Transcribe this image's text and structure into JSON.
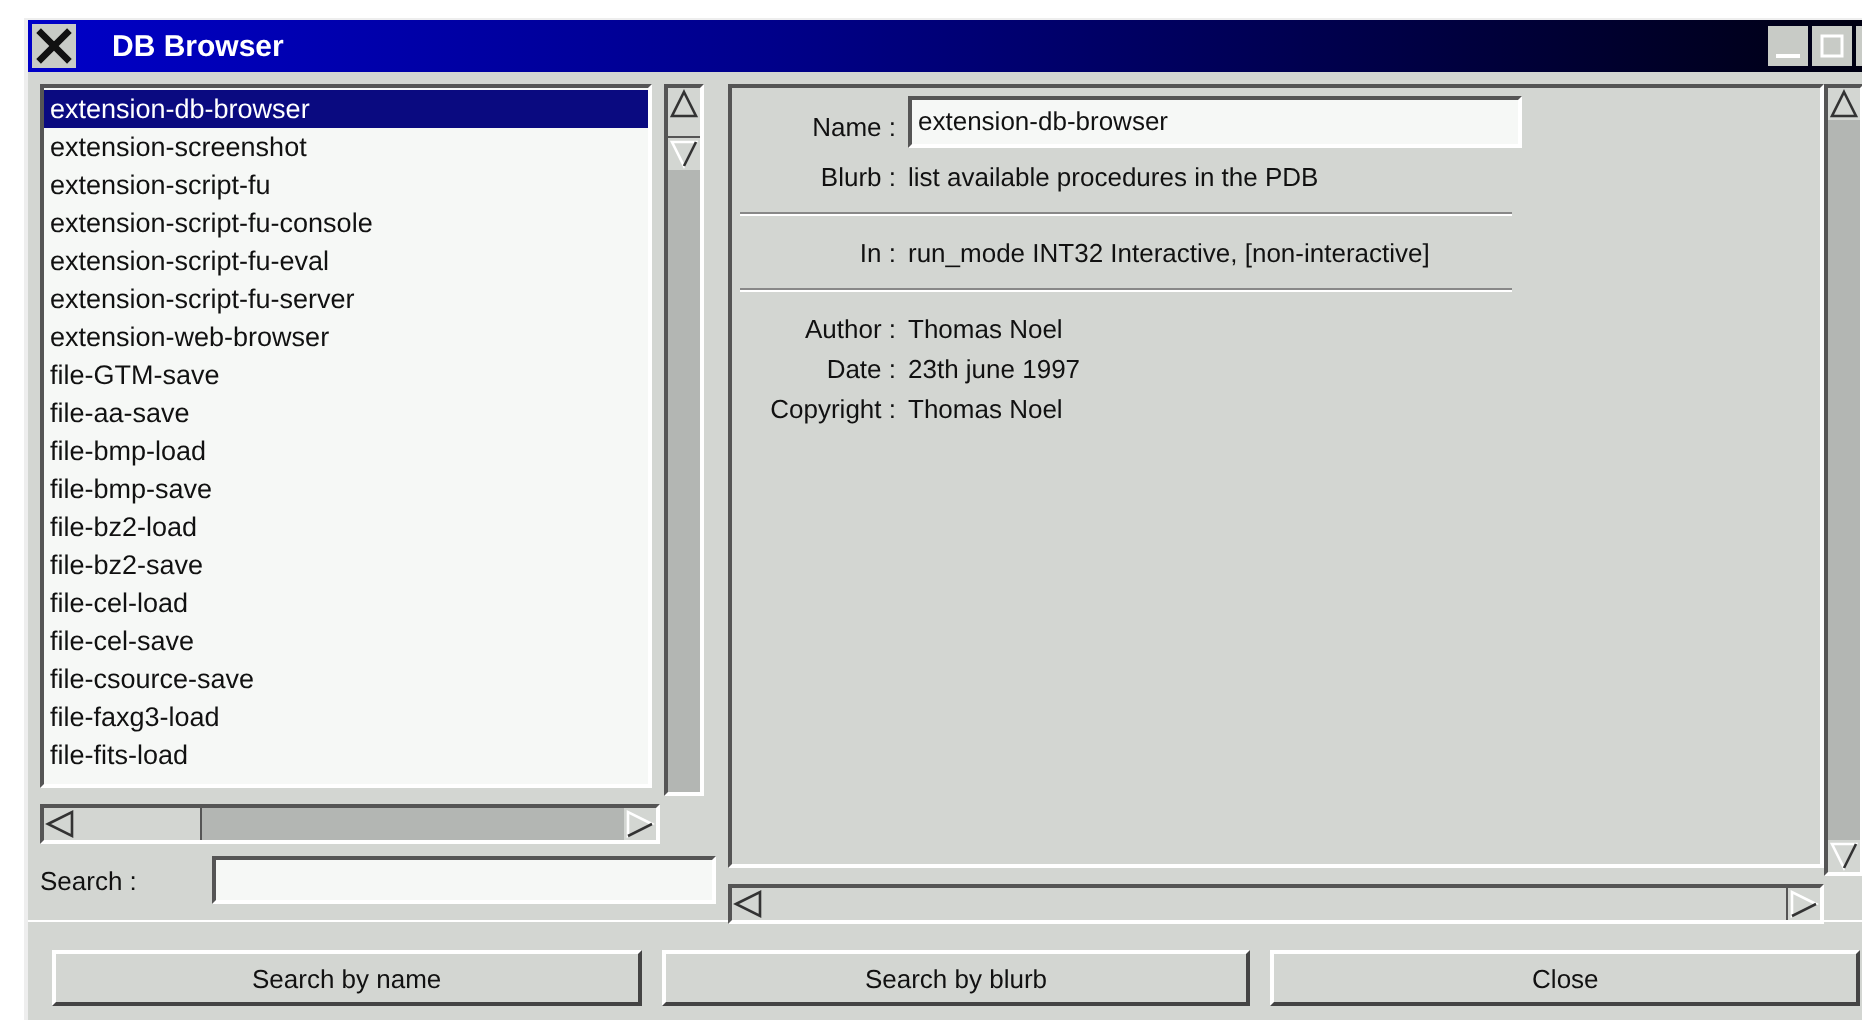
{
  "window": {
    "title": "DB Browser"
  },
  "procedures": [
    {
      "name": "extension-db-browser",
      "selected": true
    },
    {
      "name": "extension-screenshot",
      "selected": false
    },
    {
      "name": "extension-script-fu",
      "selected": false
    },
    {
      "name": "extension-script-fu-console",
      "selected": false
    },
    {
      "name": "extension-script-fu-eval",
      "selected": false
    },
    {
      "name": "extension-script-fu-server",
      "selected": false
    },
    {
      "name": "extension-web-browser",
      "selected": false
    },
    {
      "name": "file-GTM-save",
      "selected": false
    },
    {
      "name": "file-aa-save",
      "selected": false
    },
    {
      "name": "file-bmp-load",
      "selected": false
    },
    {
      "name": "file-bmp-save",
      "selected": false
    },
    {
      "name": "file-bz2-load",
      "selected": false
    },
    {
      "name": "file-bz2-save",
      "selected": false
    },
    {
      "name": "file-cel-load",
      "selected": false
    },
    {
      "name": "file-cel-save",
      "selected": false
    },
    {
      "name": "file-csource-save",
      "selected": false
    },
    {
      "name": "file-faxg3-load",
      "selected": false
    },
    {
      "name": "file-fits-load",
      "selected": false
    }
  ],
  "search": {
    "label": "Search :"
  },
  "detail_groups": [
    {
      "rows": [
        {
          "label": "Name :",
          "value": "extension-db-browser",
          "kind": "field"
        },
        {
          "label": "Blurb :",
          "value": "list available procedures in the PDB",
          "kind": "text"
        }
      ]
    },
    {
      "rows": [
        {
          "label": "In :",
          "value": "run_mode INT32 Interactive, [non-interactive]",
          "kind": "text"
        }
      ]
    },
    {
      "rows": [
        {
          "label": "Author :",
          "value": "Thomas Noel",
          "kind": "text"
        },
        {
          "label": "Date :",
          "value": "23th june 1997",
          "kind": "text"
        },
        {
          "label": "Copyright :",
          "value": "Thomas Noel",
          "kind": "text"
        }
      ]
    }
  ],
  "buttons": [
    "Search by name",
    "Search by blurb",
    "Close"
  ]
}
